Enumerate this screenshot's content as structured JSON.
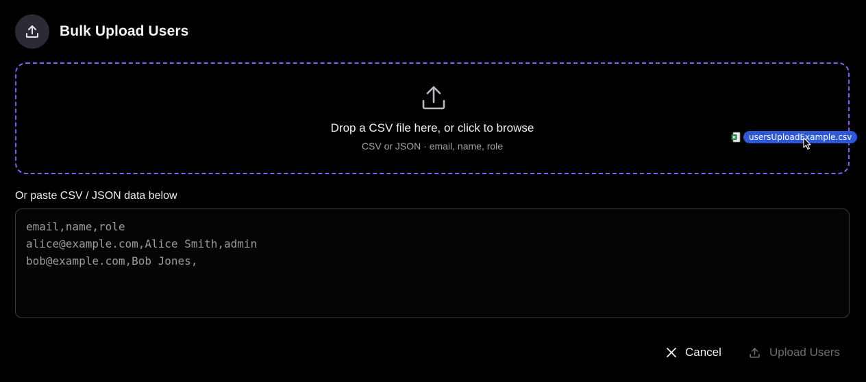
{
  "header": {
    "title": "Bulk Upload Users",
    "icon": "upload-icon"
  },
  "dropzone": {
    "title": "Drop a CSV file here, or click to browse",
    "subtitle": "CSV or JSON · email, name, role",
    "icon": "upload-icon",
    "border_color": "#8b5cf6"
  },
  "drag_ghost": {
    "file_name": "usersUploadExample.csv",
    "icon": "excel-file-icon",
    "chip_color": "#2d58d6"
  },
  "paste": {
    "label": "Or paste CSV / JSON data below",
    "placeholder": "email,name,role\nalice@example.com,Alice Smith,admin\nbob@example.com,Bob Jones,"
  },
  "actions": {
    "cancel_label": "Cancel",
    "cancel_icon": "close-icon",
    "upload_label": "Upload Users",
    "upload_icon": "upload-icon",
    "upload_disabled": true
  },
  "colors": {
    "background": "#000000",
    "accent": "#8b5cf6",
    "muted_text": "#a3a3ad",
    "disabled_text": "#6c6c75"
  }
}
